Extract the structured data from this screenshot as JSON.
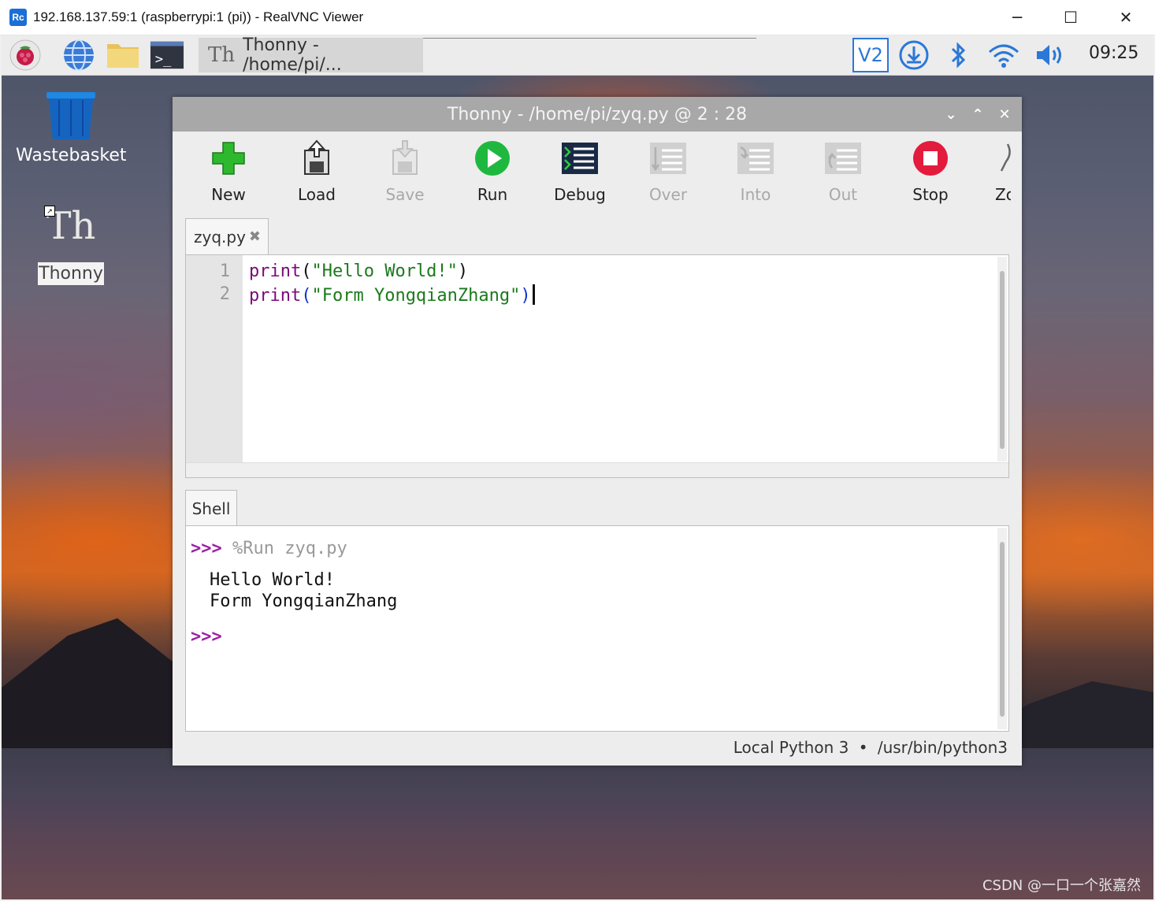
{
  "vnc_window": {
    "title": "192.168.137.59:1 (raspberrypi:1 (pi)) - RealVNC Viewer",
    "logo": "Rc",
    "minimize_icon": "─",
    "maximize_icon": "☐",
    "close_icon": "✕"
  },
  "taskbar": {
    "task_title": "Thonny  -  /home/pi/...",
    "task_icon": "Th",
    "tray_vnc": "V2",
    "clock": "09:25"
  },
  "desktop": {
    "icons": [
      {
        "label": "Wastebasket",
        "icon": "trash-icon"
      },
      {
        "label": "Thonny",
        "icon": "thonny-icon",
        "glyph": "Th"
      }
    ]
  },
  "thonny": {
    "title": "Thonny  -  /home/pi/zyq.py  @  2 : 28",
    "window_controls": {
      "minimize": "⌄",
      "maximize": "⌃",
      "close": "✕"
    },
    "toolbar": [
      {
        "label": "New",
        "icon": "new-file-icon",
        "enabled": true
      },
      {
        "label": "Load",
        "icon": "load-icon",
        "enabled": true
      },
      {
        "label": "Save",
        "icon": "save-icon",
        "enabled": false
      },
      {
        "label": "Run",
        "icon": "run-icon",
        "enabled": true
      },
      {
        "label": "Debug",
        "icon": "debug-icon",
        "enabled": true
      },
      {
        "label": "Over",
        "icon": "step-over-icon",
        "enabled": false
      },
      {
        "label": "Into",
        "icon": "step-into-icon",
        "enabled": false
      },
      {
        "label": "Out",
        "icon": "step-out-icon",
        "enabled": false
      },
      {
        "label": "Stop",
        "icon": "stop-icon",
        "enabled": true
      },
      {
        "label": "Zo",
        "icon": "zoom-icon",
        "enabled": true
      }
    ],
    "editor": {
      "tab_label": "zyq.py",
      "tab_close": "✖",
      "line_numbers": [
        "1",
        "2"
      ],
      "lines": [
        {
          "func": "print",
          "open": "(",
          "string": "\"Hello World!\"",
          "close": ")"
        },
        {
          "func": "print",
          "open": "(",
          "string": "\"Form YongqianZhang\"",
          "close": ")"
        }
      ]
    },
    "shell": {
      "tab_label": "Shell",
      "prompt": ">>>",
      "command": "%Run zyq.py",
      "output": [
        "Hello World!",
        "Form YongqianZhang"
      ],
      "prompt2": ">>>"
    },
    "status": {
      "interpreter": "Local Python 3",
      "separator": "•",
      "path": "/usr/bin/python3"
    }
  },
  "watermark": "CSDN @一口一个张嘉然",
  "colors": {
    "keyword": "#7a0a7a",
    "string": "#1b7a1b",
    "prompt": "#9d1fa5",
    "titlebar": "#a8a8a8",
    "matching_paren": "#1034cc"
  }
}
